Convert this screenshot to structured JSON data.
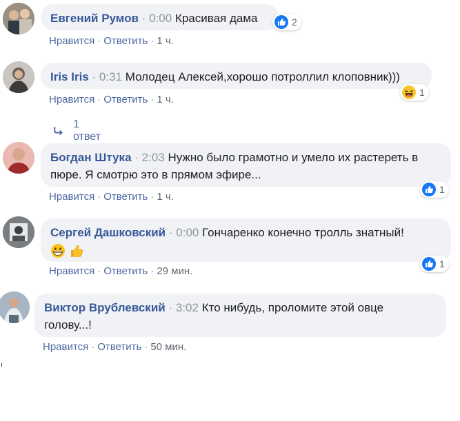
{
  "comments": [
    {
      "author": "Евгений Румов",
      "timestamp": "0:00",
      "text": "Красивая дама",
      "actions": {
        "like": "Нравится",
        "reply": "Ответить",
        "age": "1 ч."
      },
      "reaction": {
        "type": "like",
        "count": "2"
      }
    },
    {
      "author": "Iris Iris",
      "timestamp": "0:31",
      "text": "Молодец Алексей,хорошо потроллил клоповник)))",
      "actions": {
        "like": "Нравится",
        "reply": "Ответить",
        "age": "1 ч."
      },
      "reaction": {
        "type": "haha",
        "count": "1"
      },
      "replies_label": "1 ответ"
    },
    {
      "author": "Богдан Штука",
      "timestamp": "2:03",
      "text_line1": "Нужно было грамотно и умело их растереть в",
      "text_line2": "пюре. Я смотрю это в прямом эфире...",
      "actions": {
        "like": "Нравится",
        "reply": "Ответить",
        "age": "1 ч."
      },
      "reaction": {
        "type": "like",
        "count": "1"
      }
    },
    {
      "author": "Сергей Дашковский",
      "timestamp": "0:00",
      "text": "Гончаренко конечно тролль знатный!",
      "emojis": [
        "grinning-face",
        "thumbs-up"
      ],
      "actions": {
        "like": "Нравится",
        "reply": "Ответить",
        "age": "29 мин."
      },
      "reaction": {
        "type": "like",
        "count": "1"
      }
    },
    {
      "author": "Виктор Врублевский",
      "timestamp": "3:02",
      "text_line1": "Кто нибудь, проломите этой овце",
      "text_line2": "голову...!",
      "actions": {
        "like": "Нравится",
        "reply": "Ответить",
        "age": "50 мин."
      }
    }
  ],
  "separator": "·",
  "icons": {
    "like": "like-icon",
    "haha": "haha-icon",
    "reply_arrow": "reply-arrow-icon"
  },
  "colors": {
    "author": "#385898",
    "link": "#4b67a1",
    "bubble": "#f0f2f5",
    "like_blue": "#1877f2"
  }
}
